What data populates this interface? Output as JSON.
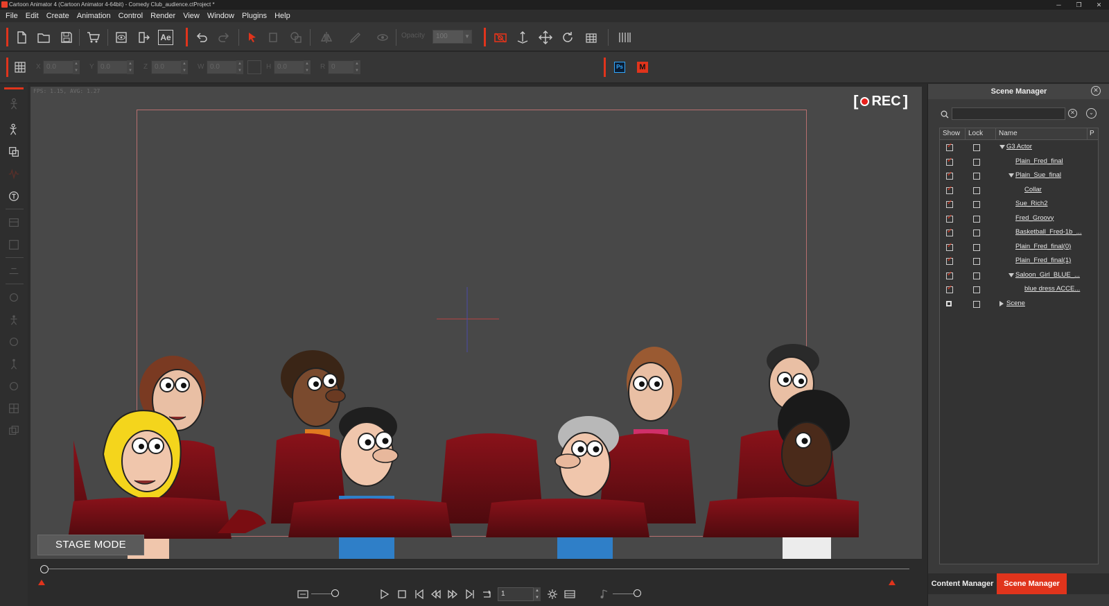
{
  "window": {
    "title": "Cartoon Animator 4  (Cartoon Animator 4-64bit) - Comedy Club_audience.ctProject *",
    "controls": [
      "─",
      "❐",
      "✕"
    ]
  },
  "menu": [
    "File",
    "Edit",
    "Create",
    "Animation",
    "Control",
    "Render",
    "View",
    "Window",
    "Plugins",
    "Help"
  ],
  "toolbar": {
    "opacity_label": "Opacity",
    "opacity_value": "100",
    "ae_label": "Ae"
  },
  "transform": {
    "fields": [
      {
        "label": "X",
        "value": "0.0"
      },
      {
        "label": "Y",
        "value": "0.0"
      },
      {
        "label": "Z",
        "value": "0.0"
      },
      {
        "label": "W",
        "value": "0.0"
      },
      {
        "label": "H",
        "value": "0.0"
      },
      {
        "label": "R",
        "value": "0"
      }
    ],
    "ps_label": "Ps",
    "m_label": "M"
  },
  "viewport": {
    "fps_info": "FPS: 1.15, AVG: 1.27",
    "rec_label": "REC",
    "stage_mode": "STAGE MODE"
  },
  "playback": {
    "frame_value": "1"
  },
  "scene_manager": {
    "title": "Scene Manager",
    "search_placeholder": "",
    "columns": [
      "Show",
      "Lock",
      "Name",
      "P"
    ],
    "rows": [
      {
        "name": "G3 Actor",
        "show": true,
        "lock": false,
        "indent": 0,
        "expander": "down"
      },
      {
        "name": "Plain_Fred_final",
        "show": true,
        "lock": false,
        "indent": 1,
        "expander": "none"
      },
      {
        "name": "Plain_Sue_final",
        "show": true,
        "lock": false,
        "indent": 1,
        "expander": "down"
      },
      {
        "name": "Collar",
        "show": true,
        "lock": false,
        "indent": 2,
        "expander": "none"
      },
      {
        "name": "Sue_Rich2",
        "show": true,
        "lock": false,
        "indent": 1,
        "expander": "none"
      },
      {
        "name": "Fred_Groovy",
        "show": true,
        "lock": false,
        "indent": 1,
        "expander": "none"
      },
      {
        "name": "Basketball_Fred-1b_...",
        "show": true,
        "lock": false,
        "indent": 1,
        "expander": "none"
      },
      {
        "name": "Plain_Fred_final(0)",
        "show": true,
        "lock": false,
        "indent": 1,
        "expander": "none"
      },
      {
        "name": "Plain_Fred_final(1)",
        "show": true,
        "lock": false,
        "indent": 1,
        "expander": "none"
      },
      {
        "name": "Saloon_Girl_BLUE_...",
        "show": true,
        "lock": false,
        "indent": 1,
        "expander": "down"
      },
      {
        "name": "blue dress ACCE...",
        "show": true,
        "lock": false,
        "indent": 2,
        "expander": "none"
      },
      {
        "name": "Scene",
        "show": "square",
        "lock": false,
        "indent": 0,
        "expander": "right"
      }
    ],
    "tabs": [
      {
        "label": "Content Manager",
        "active": false
      },
      {
        "label": "Scene Manager",
        "active": true
      }
    ]
  },
  "colors": {
    "accent": "#e0341c",
    "panel": "#3a3a3a",
    "viewport": "#484848",
    "seat": "#6e0d12"
  }
}
